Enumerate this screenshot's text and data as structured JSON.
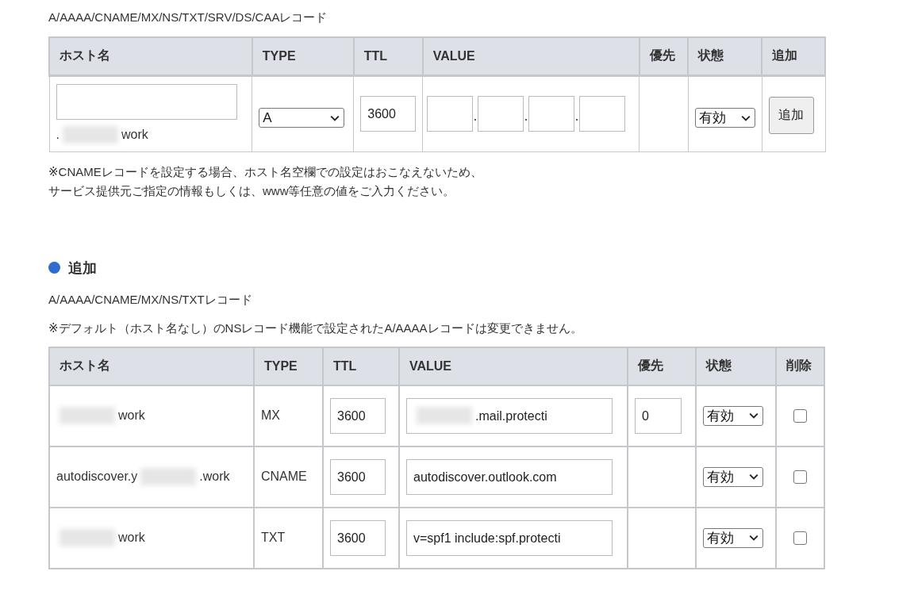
{
  "page_title": "A/AAAA/CNAME/MX/NS/TXT/SRV/DS/CAAレコード",
  "add_form": {
    "columns": [
      "ホスト名",
      "TYPE",
      "TTL",
      "VALUE",
      "優先",
      "状態",
      "追加"
    ],
    "host_suffix": [
      {
        "kind": "text",
        "text": "."
      },
      {
        "kind": "blur"
      },
      {
        "kind": "text",
        "text": "work"
      }
    ],
    "type": "A",
    "ttl": "3600",
    "status": "有効",
    "button": "追加"
  },
  "notes": [
    "※CNAMEレコードを設定する場合、ホスト名空欄での設定はおこなえないため、",
    "サービス提供元ご指定の情報もしくは、www等任意の値をご入力ください。"
  ],
  "section_heading": "追加",
  "records_caption": "A/AAAA/CNAME/MX/NS/TXTレコード",
  "records_notice": "※デフォルト（ホスト名なし）のNSレコード機能で設定されたA/AAAAレコードは変更できません。",
  "records": {
    "columns": [
      "ホスト名",
      "TYPE",
      "TTL",
      "VALUE",
      "優先",
      "状態",
      "削除"
    ],
    "rows": [
      {
        "host": [
          {
            "kind": "blur"
          },
          {
            "kind": "text",
            "text": "work"
          }
        ],
        "type": "MX",
        "ttl": "3600",
        "value": [
          {
            "kind": "blur"
          },
          {
            "kind": "text",
            "text": ".mail.protecti"
          }
        ],
        "priority": "0",
        "status": "有効",
        "delete": false
      },
      {
        "host": [
          {
            "kind": "text",
            "text": "autodiscover.y"
          },
          {
            "kind": "blur"
          },
          {
            "kind": "text",
            "text": ".work"
          }
        ],
        "type": "CNAME",
        "ttl": "3600",
        "value": [
          {
            "kind": "text",
            "text": "autodiscover.outlook.com"
          }
        ],
        "status": "有効",
        "delete": false
      },
      {
        "host": [
          {
            "kind": "blur"
          },
          {
            "kind": "text",
            "text": "work"
          }
        ],
        "type": "TXT",
        "ttl": "3600",
        "value": [
          {
            "kind": "text",
            "text": "v=spf1 include:spf.protecti"
          }
        ],
        "status": "有効",
        "delete": false
      }
    ]
  }
}
